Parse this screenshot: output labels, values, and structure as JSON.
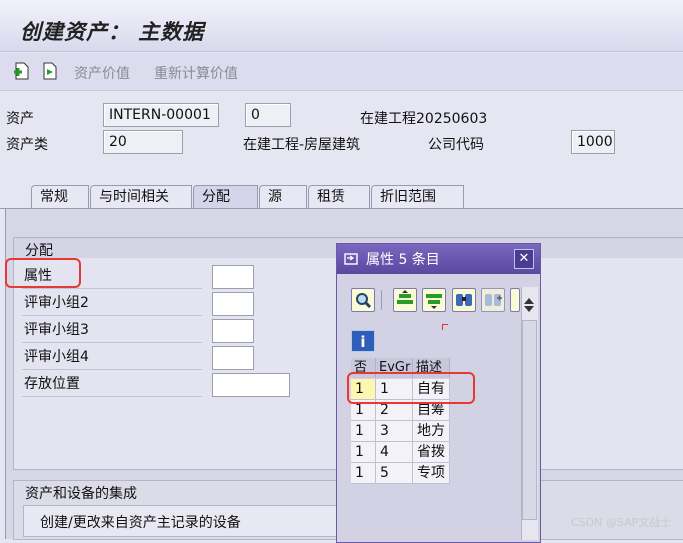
{
  "window": {
    "title": "创建资产： 主数据"
  },
  "toolbar": {
    "asset_value": "资产价值",
    "recalc_value": "重新计算价值"
  },
  "header": {
    "asset_label": "资产",
    "asset_number": "INTERN-00001",
    "sub_number": "0",
    "asset_description": "在建工程20250603",
    "asset_class_label": "资产类",
    "asset_class": "20",
    "asset_class_description": "在建工程-房屋建筑",
    "company_code_label": "公司代码",
    "company_code": "1000"
  },
  "tabs": [
    "常规",
    "与时间相关",
    "分配",
    "源",
    "租赁",
    "折旧范围"
  ],
  "allocation": {
    "group_title": "分配",
    "rows": [
      {
        "label": "属性",
        "value": ""
      },
      {
        "label": "评审小组2",
        "value": ""
      },
      {
        "label": "评审小组3",
        "value": ""
      },
      {
        "label": "评审小组4",
        "value": ""
      },
      {
        "label": "存放位置",
        "value": ""
      }
    ]
  },
  "equipment": {
    "group_title": "资产和设备的集成",
    "checkbox_label": "创建/更改来自资产主记录的设备"
  },
  "popup": {
    "title": "属性 5 条目",
    "close": "✕",
    "info": "i",
    "columns": [
      "否",
      "EvGr",
      "描述"
    ],
    "rows": [
      {
        "no": "1",
        "evgr": "1",
        "desc": "自有"
      },
      {
        "no": "1",
        "evgr": "2",
        "desc": "自筹"
      },
      {
        "no": "1",
        "evgr": "3",
        "desc": "地方"
      },
      {
        "no": "1",
        "evgr": "4",
        "desc": "省拨"
      },
      {
        "no": "1",
        "evgr": "5",
        "desc": "专项"
      }
    ]
  },
  "watermark": "CSDN @SAP文战士"
}
